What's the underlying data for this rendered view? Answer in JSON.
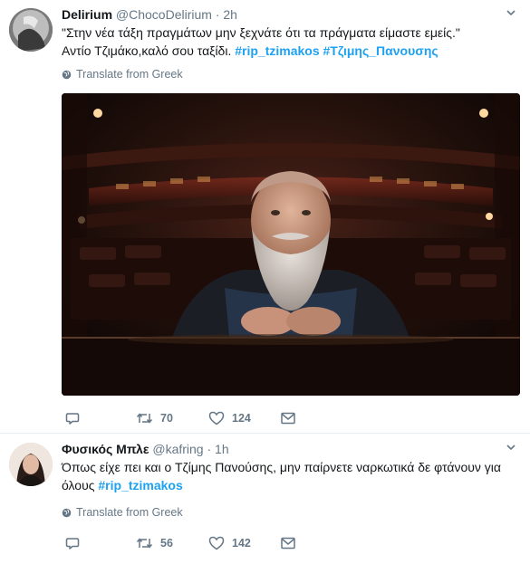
{
  "tweets": [
    {
      "name": "Delirium",
      "handle": "@ChocoDelirium",
      "dot": "·",
      "time": "2h",
      "text_line1": "\"Στην νέα τάξη πραγμάτων μην ξεχνάτε ότι τα πράγματα είμαστε εμείς.\"",
      "text_line2_plain": "Αντίο Τζιμάκο,καλό σου ταξίδι. ",
      "hashtag1": "#rip_tzimakos",
      "hashtag2": "#Τζιμης_Πανουσης",
      "translate": "Translate from Greek",
      "retweets": "70",
      "likes": "124"
    },
    {
      "name": "Φυσικός Μπλε",
      "handle": "@kafring",
      "dot": "·",
      "time": "1h",
      "text_line1": "Όπως είχε πει και ο Τζίμης Πανούσης, μην παίρνετε ναρκωτικά δε φτάνουν για",
      "text_line2_plain": "όλους ",
      "hashtag1": "#rip_tzimakos",
      "translate": "Translate from Greek",
      "retweets": "56",
      "likes": "142"
    }
  ],
  "icons": {
    "reply": "reply-icon",
    "retweet": "retweet-icon",
    "like": "heart-icon",
    "dm": "envelope-icon",
    "menu": "chevron-down-icon",
    "translate": "globe-icon"
  },
  "colors": {
    "link": "#1da1f2",
    "secondary": "#657786",
    "text": "#14171a",
    "border": "#e6ecf0"
  }
}
